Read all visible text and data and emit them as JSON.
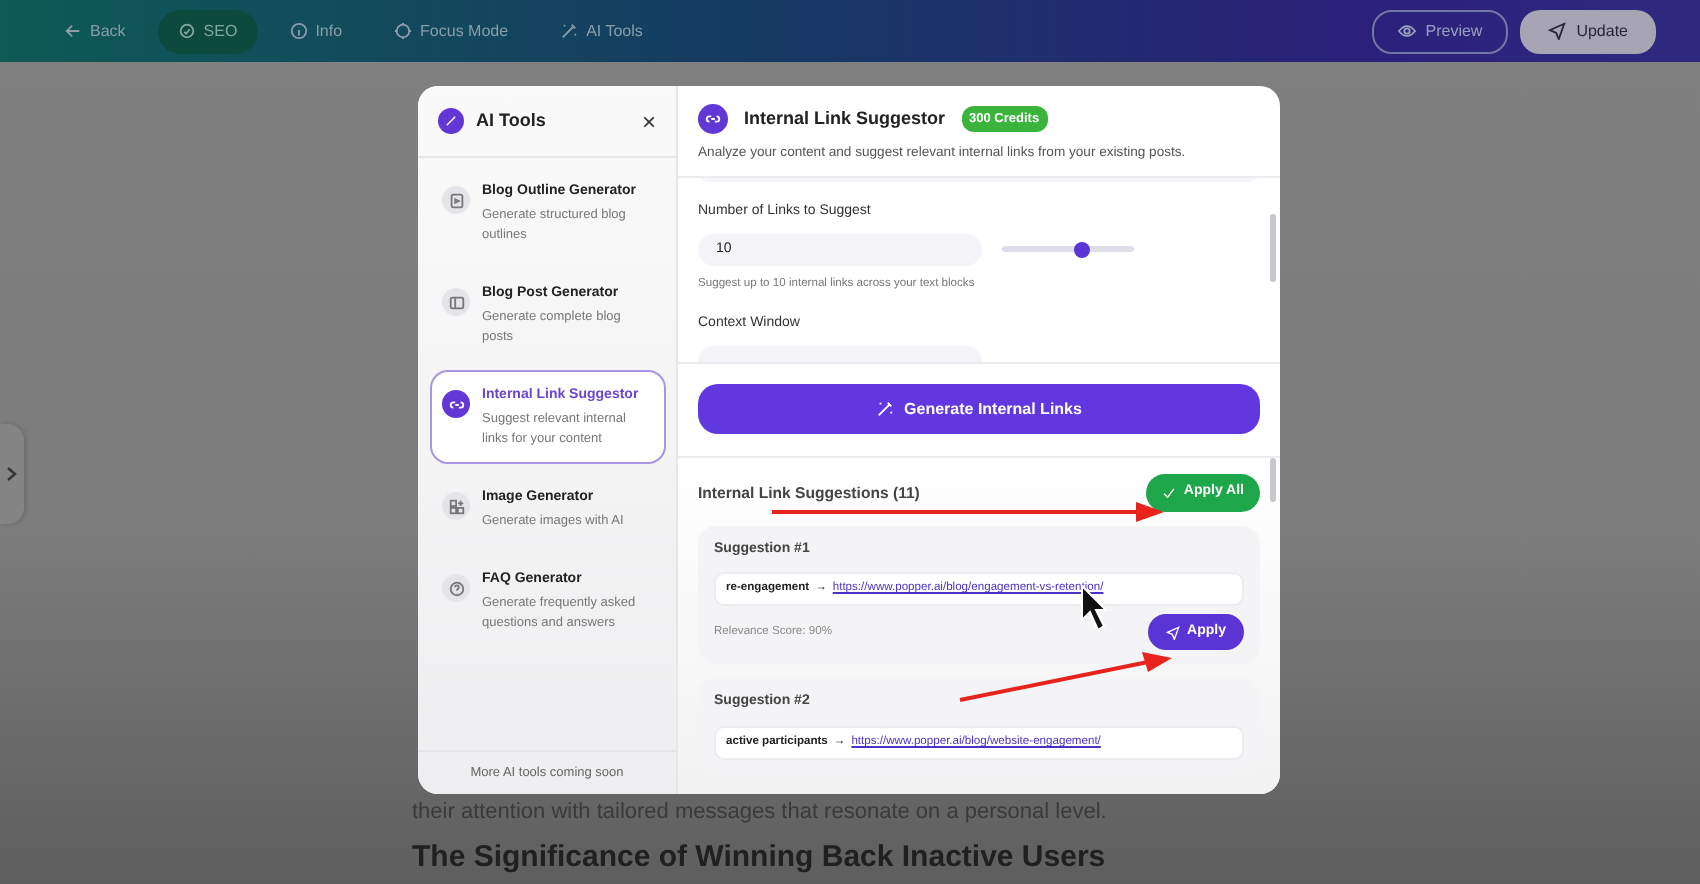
{
  "topbar": {
    "back": "Back",
    "tabs": [
      {
        "label": "SEO",
        "selected": true
      },
      {
        "label": "Info",
        "selected": false
      },
      {
        "label": "Focus Mode",
        "selected": false
      },
      {
        "label": "AI Tools",
        "selected": false
      }
    ],
    "preview": "Preview",
    "update": "Update"
  },
  "article": {
    "lines": [
      "their attention with tailored messages that resonate on a personal level."
    ],
    "heading": "The Significance of Winning Back Inactive Users"
  },
  "modal": {
    "title": "AI Tools",
    "close": "×",
    "tools": [
      {
        "name": "Blog Outline Generator",
        "desc": "Generate structured blog outlines",
        "selected": false
      },
      {
        "name": "Blog Post Generator",
        "desc": "Generate complete blog posts",
        "selected": false
      },
      {
        "name": "Internal Link Suggestor",
        "desc": "Suggest relevant internal links for your content",
        "selected": true
      },
      {
        "name": "Image Generator",
        "desc": "Generate images with AI",
        "selected": false
      },
      {
        "name": "FAQ Generator",
        "desc": "Generate frequently asked questions and answers",
        "selected": false
      }
    ],
    "footer": "More AI tools coming soon",
    "tool": {
      "title": "Internal Link Suggestor",
      "credits": "300 Credits",
      "desc": "Analyze your content and suggest relevant internal links from your existing posts.",
      "links_label": "Number of Links to Suggest",
      "links_value": "10",
      "slider": {
        "level": 0.6
      },
      "links_help": "Suggest up to 10 internal links across your text blocks",
      "context_label": "Context Window",
      "generate": "Generate Internal Links"
    },
    "suggestions": {
      "title": "Internal Link Suggestions (11)",
      "apply_all": "Apply All",
      "items": [
        {
          "title": "Suggestion #1",
          "anchor": "re-engagement",
          "arrow": "→",
          "url": "https://www.popper.ai/blog/engagement-vs-retention/",
          "score": "Relevance Score: 90%",
          "apply": "Apply"
        },
        {
          "title": "Suggestion #2",
          "anchor": "active participants",
          "arrow": "→",
          "url": "https://www.popper.ai/blog/website-engagement/"
        }
      ]
    }
  }
}
